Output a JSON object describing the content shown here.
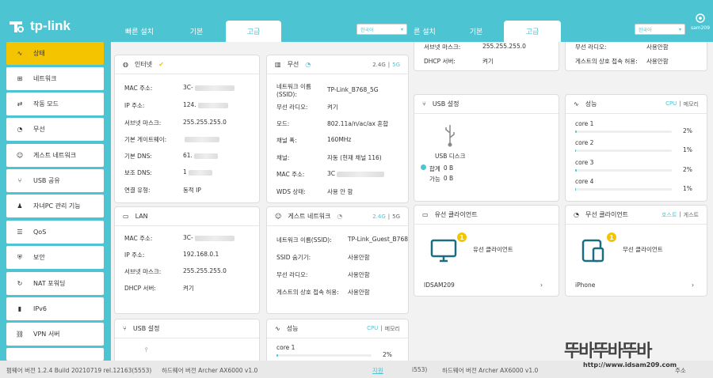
{
  "brand": {
    "name": "tp-link"
  },
  "header": {
    "logout": "sam209"
  },
  "tabs_left": [
    {
      "label": "빠른 설치"
    },
    {
      "label": "기본"
    },
    {
      "label": "고급"
    }
  ],
  "tabs_right": [
    {
      "label": "른 설치"
    },
    {
      "label": "기본"
    },
    {
      "label": "고급"
    }
  ],
  "lang_select": "한국어",
  "sidebar": {
    "items": [
      {
        "label": "상태",
        "icon": "pulse-icon"
      },
      {
        "label": "네트워크",
        "icon": "network-icon"
      },
      {
        "label": "작동 모드",
        "icon": "mode-icon"
      },
      {
        "label": "무선",
        "icon": "wifi-icon"
      },
      {
        "label": "게스트 네트워크",
        "icon": "guest-icon"
      },
      {
        "label": "USB 공유",
        "icon": "usb-icon"
      },
      {
        "label": "자녀PC 관리 기능",
        "icon": "parental-icon"
      },
      {
        "label": "QoS",
        "icon": "qos-icon"
      },
      {
        "label": "보안",
        "icon": "shield-icon"
      },
      {
        "label": "NAT 포워딩",
        "icon": "nat-icon"
      },
      {
        "label": "IPv6",
        "icon": "ipv6-icon"
      },
      {
        "label": "VPN 서버",
        "icon": "vpn-icon"
      }
    ]
  },
  "internet": {
    "title": "인터넷",
    "rows": [
      {
        "k": "MAC 주소:",
        "v": "3C-"
      },
      {
        "k": "IP 주소:",
        "v": "124."
      },
      {
        "k": "서브넷 마스크:",
        "v": "255.255.255.0"
      },
      {
        "k": "기본 게이트웨이:",
        "v": ""
      },
      {
        "k": "기본 DNS:",
        "v": "61."
      },
      {
        "k": "보조 DNS:",
        "v": "1"
      },
      {
        "k": "연결 유형:",
        "v": "동적 IP"
      }
    ]
  },
  "wireless": {
    "title": "무선",
    "band_a": "2.4G",
    "band_b": "5G",
    "rows": [
      {
        "k": "네트워크 이름",
        "k2": "(SSID):",
        "v": "TP-Link_B768_5G"
      },
      {
        "k": "무선 라디오:",
        "v": "켜기"
      },
      {
        "k": "모드:",
        "v": "802.11a/n/ac/ax 혼합"
      },
      {
        "k": "채널 폭:",
        "v": "160MHz"
      },
      {
        "k": "채널:",
        "v": "자동 (현재 채널 116)"
      },
      {
        "k": "MAC 주소:",
        "v": "3C"
      },
      {
        "k": "WDS 상태:",
        "v": "사용 안 함"
      }
    ]
  },
  "lan": {
    "title": "LAN",
    "rows": [
      {
        "k": "MAC 주소:",
        "v": "3C-"
      },
      {
        "k": "IP 주소:",
        "v": "192.168.0.1"
      },
      {
        "k": "서브넷 마스크:",
        "v": "255.255.255.0"
      },
      {
        "k": "DHCP 서버:",
        "v": "켜기"
      }
    ]
  },
  "guest": {
    "title": "게스트 네트워크",
    "band_a": "2.4G",
    "band_b": "5G",
    "rows": [
      {
        "k": "네트워크 이름(SSID):",
        "v": "TP-Link_Guest_B768"
      },
      {
        "k": "SSID 숨기기:",
        "v": "사용안함"
      },
      {
        "k": "무선 라디오:",
        "v": "사용안함"
      },
      {
        "k": "게스트의 상호 접속 허용:",
        "v": "사용안함"
      }
    ]
  },
  "usb_left": {
    "title": "USB 설정"
  },
  "perf_left": {
    "title": "성능",
    "cpu": "CPU",
    "mem": "메모리",
    "core": "core 1",
    "pct": "2%",
    "value": 0.02
  },
  "top_mid": {
    "rows": [
      {
        "k": "서브넷 마스크:",
        "v": "255.255.255.0"
      },
      {
        "k": "DHCP 서버:",
        "v": "켜기"
      }
    ]
  },
  "top_right": {
    "rows": [
      {
        "k": "무선 라디오:",
        "v": "사용안함"
      },
      {
        "k": "게스트의 상호 접속 허용:",
        "v": "사용안함"
      }
    ]
  },
  "usb_right": {
    "title": "USB 설정",
    "disk": "USB 디스크",
    "total_label": "합계",
    "total": "0 B",
    "avail_label": "가능",
    "avail": "0 B"
  },
  "perf_right": {
    "title": "성능",
    "cpu": "CPU",
    "mem": "메모리",
    "cores": [
      {
        "name": "core 1",
        "pct": "2%",
        "value": 0.02
      },
      {
        "name": "core 2",
        "pct": "1%",
        "value": 0.01
      },
      {
        "name": "core 3",
        "pct": "2%",
        "value": 0.02
      },
      {
        "name": "core 4",
        "pct": "1%",
        "value": 0.01
      }
    ]
  },
  "wired_clients": {
    "title": "유선 클라이언트",
    "label": "유선 클라이언트",
    "count": "1",
    "device": "IDSAM209"
  },
  "wireless_clients": {
    "title": "무선 클라이언트",
    "host": "호스트",
    "guest": "게스트",
    "label": "무선 클라이언트",
    "count": "1",
    "device": "iPhone"
  },
  "footer": {
    "firmware": "펌웨어 버전 1.2.4 Build 20210719 rel.12163(5553)",
    "hardware": "하드웨어 버전 Archer AX6000 v1.0",
    "support": "지원",
    "build2": "i553)",
    "hardware2": "하드웨어 버전 Archer AX6000 v1.0",
    "tail": "주소"
  },
  "watermark": {
    "line1": "뚜바뚜바뚜바",
    "line2": "http://www.idsam209.com"
  }
}
